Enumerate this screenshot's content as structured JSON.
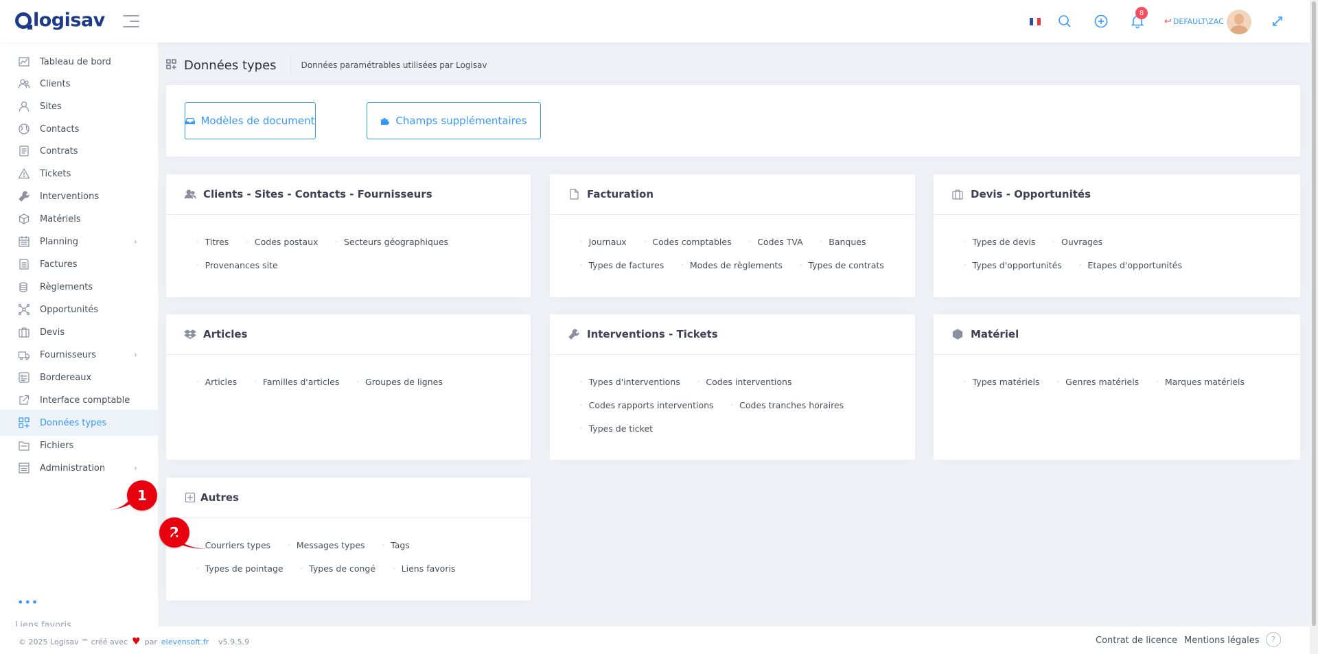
{
  "app": {
    "name": "logisav"
  },
  "header": {
    "badge_count": "8",
    "user": "DEFAULT\\ZAC",
    "language_flag": "fr",
    "colors": {
      "accent": "#3699ff",
      "badge": "#f64e60",
      "logo": "#1e3a8a"
    }
  },
  "sidebar": {
    "items": [
      {
        "label": "Tableau de bord",
        "icon": "chart-icon"
      },
      {
        "label": "Clients",
        "icon": "users-icon"
      },
      {
        "label": "Sites",
        "icon": "user-icon"
      },
      {
        "label": "Contacts",
        "icon": "globe-icon"
      },
      {
        "label": "Contrats",
        "icon": "contract-icon"
      },
      {
        "label": "Tickets",
        "icon": "warning-icon"
      },
      {
        "label": "Interventions",
        "icon": "wrench-icon"
      },
      {
        "label": "Matériels",
        "icon": "box-icon"
      },
      {
        "label": "Planning",
        "icon": "calendar-icon",
        "has_children": true
      },
      {
        "label": "Factures",
        "icon": "invoice-icon"
      },
      {
        "label": "Règlements",
        "icon": "coins-icon"
      },
      {
        "label": "Opportunités",
        "icon": "network-icon"
      },
      {
        "label": "Devis",
        "icon": "briefcase-icon"
      },
      {
        "label": "Fournisseurs",
        "icon": "truck-icon",
        "has_children": true
      },
      {
        "label": "Bordereaux",
        "icon": "slip-icon"
      },
      {
        "label": "Interface comptable",
        "icon": "external-link-icon"
      },
      {
        "label": "Données types",
        "icon": "grid-plus-icon",
        "active": true
      },
      {
        "label": "Fichiers",
        "icon": "folder-icon"
      },
      {
        "label": "Administration",
        "icon": "admin-icon",
        "has_children": true
      }
    ],
    "more": "•••",
    "cut_item": "Liens favoris"
  },
  "page": {
    "title": "Données types",
    "subtitle": "Données paramétrables utilisées par Logisav"
  },
  "toolbar": {
    "doc_models": "Modèles de document",
    "extra_fields": "Champs supplémentaires"
  },
  "cards": [
    {
      "title": "Clients - Sites - Contacts - Fournisseurs",
      "icon": "users-icon",
      "rows": [
        [
          "Titres",
          "Codes postaux",
          "Secteurs géographiques"
        ],
        [
          "Provenances site"
        ]
      ]
    },
    {
      "title": "Facturation",
      "icon": "file-icon",
      "rows": [
        [
          "Journaux",
          "Codes comptables",
          "Codes TVA",
          "Banques"
        ],
        [
          "Types de factures",
          "Modes de règlements",
          "Types de contrats"
        ]
      ]
    },
    {
      "title": "Devis - Opportunités",
      "icon": "briefcase-icon",
      "rows": [
        [
          "Types de devis",
          "Ouvrages"
        ],
        [
          "Types d'opportunités",
          "Etapes d'opportunités"
        ]
      ]
    },
    {
      "title": "Articles",
      "icon": "dropbox-icon",
      "rows": [
        [
          "Articles",
          "Familles d'articles",
          "Groupes de lignes"
        ]
      ]
    },
    {
      "title": "Interventions - Tickets",
      "icon": "wrench-icon",
      "rows": [
        [
          "Types d'interventions",
          "Codes interventions"
        ],
        [
          "Codes rapports interventions",
          "Codes tranches horaires"
        ],
        [
          "Types de ticket"
        ]
      ]
    },
    {
      "title": "Matériel",
      "icon": "cube-icon",
      "rows": [
        [
          "Types matériels",
          "Genres matériels",
          "Marques matériels"
        ]
      ]
    },
    {
      "title": "Autres",
      "icon": "plus-square-icon",
      "rows": [
        [
          "Courriers types",
          "Messages types",
          "Tags"
        ],
        [
          "Types de pointage",
          "Types de congé",
          "Liens favoris"
        ]
      ]
    }
  ],
  "markers": [
    "1",
    "2"
  ],
  "footer": {
    "copyright": "© 2025 Logisav ™ créé avec",
    "by": "par",
    "brand": "elevensoft.fr",
    "version": "v5.9.5.9",
    "license": "Contrat de licence",
    "legal": "Mentions légales",
    "help": "?"
  }
}
